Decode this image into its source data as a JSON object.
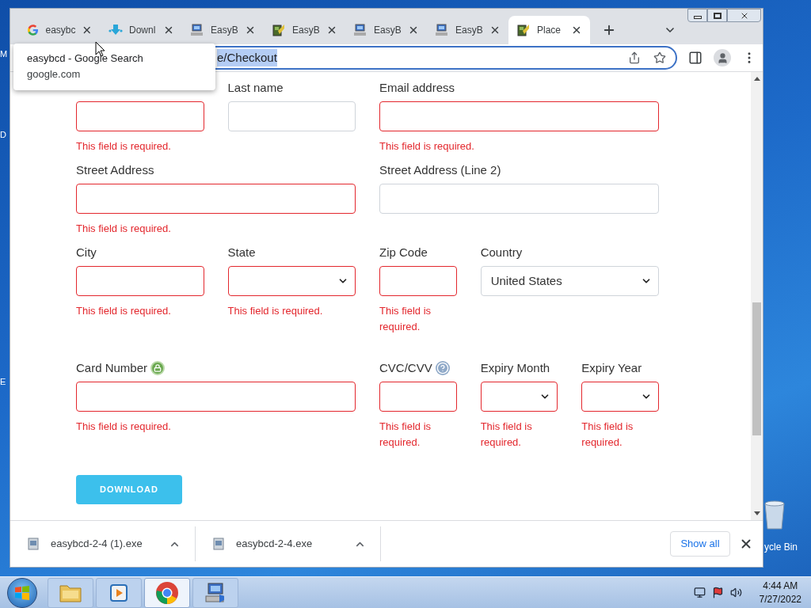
{
  "desktop": {
    "edge_labels": [
      "M",
      "D",
      "E"
    ],
    "recycle_bin_label": "ycle Bin"
  },
  "browser": {
    "tabs": [
      {
        "title": "easybc",
        "kind": "google",
        "selected": false
      },
      {
        "title": "Downl",
        "kind": "download",
        "selected": false
      },
      {
        "title": "EasyB",
        "kind": "computer",
        "selected": false
      },
      {
        "title": "EasyB",
        "kind": "installer",
        "selected": false
      },
      {
        "title": "EasyB",
        "kind": "computer",
        "selected": false
      },
      {
        "title": "EasyB",
        "kind": "computer",
        "selected": false
      },
      {
        "title": "Place",
        "kind": "installer",
        "selected": true
      }
    ],
    "hover_card": {
      "title": "easybcd - Google Search",
      "domain": "google.com"
    },
    "address_bar": {
      "url": "e/Checkout",
      "selected": true
    },
    "form": {
      "fields": [
        {
          "kind": "text",
          "invalid": true,
          "error": "This field is required."
        },
        {
          "label": "Last name",
          "kind": "text",
          "invalid": false
        },
        {
          "label": "Email address",
          "kind": "text",
          "invalid": true,
          "error": "This field is required."
        },
        {
          "label": "Street Address",
          "kind": "text",
          "invalid": true,
          "error": "This field is required."
        },
        {
          "label": "Street Address (Line 2)",
          "kind": "text",
          "invalid": false
        },
        {
          "label": "City",
          "kind": "text",
          "invalid": true,
          "error": "This field is required."
        },
        {
          "label": "State",
          "kind": "select",
          "invalid": true,
          "error": "This field is required."
        },
        {
          "label": "Zip Code",
          "kind": "text",
          "invalid": true,
          "error": "This field is required."
        },
        {
          "label": "Country",
          "kind": "select",
          "invalid": false,
          "value": "United States"
        },
        {
          "label": "Card Number",
          "kind": "text",
          "invalid": true,
          "error": "This field is required."
        },
        {
          "label": "CVC/CVV",
          "kind": "text",
          "invalid": true,
          "error": "This field is required."
        },
        {
          "label": "Expiry Month",
          "kind": "select",
          "invalid": true,
          "error": "This field is required."
        },
        {
          "label": "Expiry Year",
          "kind": "select",
          "invalid": true,
          "error": "This field is required."
        }
      ],
      "submit": "DOWNLOAD"
    },
    "downloads": [
      {
        "filename": "easybcd-2-4 (1).exe"
      },
      {
        "filename": "easybcd-2-4.exe"
      }
    ],
    "show_all": "Show all"
  },
  "taskbar": {
    "apps": [
      {
        "kind": "explorer",
        "selected": false
      },
      {
        "kind": "media",
        "selected": false
      },
      {
        "kind": "chrome",
        "selected": true
      },
      {
        "kind": "setup",
        "selected": false
      }
    ],
    "time": "4:44 AM",
    "date": "7/27/2022"
  }
}
